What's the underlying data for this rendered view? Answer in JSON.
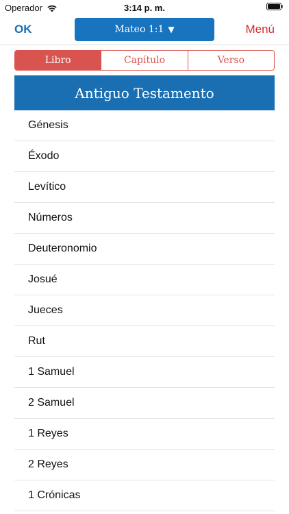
{
  "status_bar": {
    "carrier": "Operador",
    "time": "3:14 p. m."
  },
  "nav": {
    "ok_label": "OK",
    "reference_label": "Mateo 1:1",
    "reference_caret": "▼",
    "menu_label": "Menú"
  },
  "tabs": [
    {
      "label": "Libro",
      "active": true
    },
    {
      "label": "Capítulo",
      "active": false
    },
    {
      "label": "Verso",
      "active": false
    }
  ],
  "section": {
    "title": "Antiguo Testamento"
  },
  "books": [
    {
      "label": "Génesis"
    },
    {
      "label": "Éxodo"
    },
    {
      "label": "Levítico"
    },
    {
      "label": "Números"
    },
    {
      "label": "Deuteronomio"
    },
    {
      "label": "Josué"
    },
    {
      "label": "Jueces"
    },
    {
      "label": "Rut"
    },
    {
      "label": "1 Samuel"
    },
    {
      "label": "2 Samuel"
    },
    {
      "label": "1 Reyes"
    },
    {
      "label": "2 Reyes"
    },
    {
      "label": "1 Crónicas"
    }
  ],
  "colors": {
    "primary_blue": "#1a6fb3",
    "accent_red": "#d9534f",
    "menu_red": "#d32a2a"
  },
  "icons": {
    "wifi": "wifi-icon",
    "battery": "battery-icon",
    "caret": "caret-down-icon"
  }
}
